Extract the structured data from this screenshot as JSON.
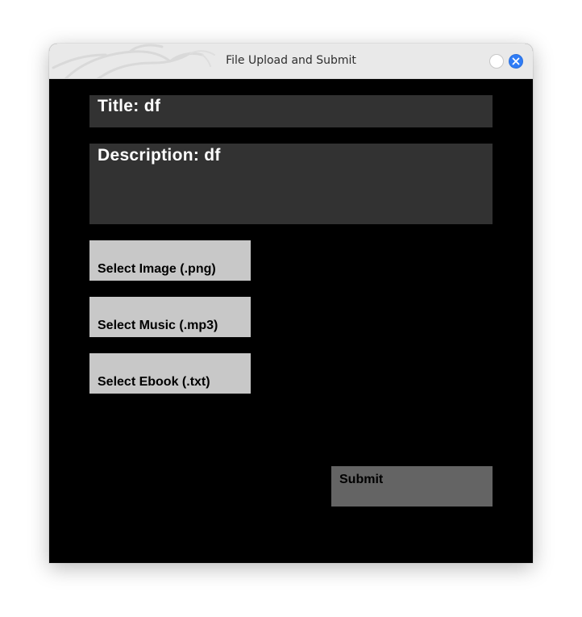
{
  "window": {
    "title": "File Upload and Submit"
  },
  "form": {
    "title_text": "Title: df",
    "description_text": "Description: df"
  },
  "buttons": {
    "select_image": "Select Image (.png)",
    "select_music": "Select Music (.mp3)",
    "select_ebook": "Select Ebook (.txt)",
    "submit": "Submit"
  },
  "icons": {
    "minimize": "minimize-icon",
    "close": "close-icon",
    "background": "dragon-watermark"
  },
  "colors": {
    "background": "#000000",
    "field_bg": "#323232",
    "file_button_bg": "#c8c8c8",
    "submit_bg": "#646464",
    "close_button": "#2f7cf6"
  }
}
